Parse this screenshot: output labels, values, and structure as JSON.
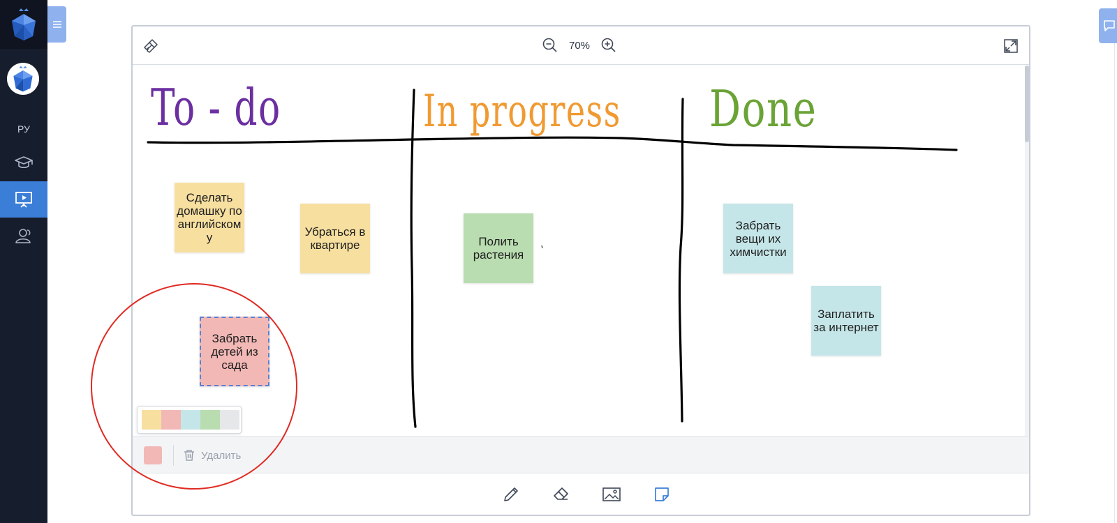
{
  "sidebar": {
    "language": "РУ",
    "items": [
      {
        "icon": "graduation-cap-icon",
        "active": false
      },
      {
        "icon": "presentation-board-icon",
        "active": true
      },
      {
        "icon": "users-icon",
        "active": false
      }
    ]
  },
  "board": {
    "zoom": "70%",
    "columns": [
      {
        "heading": "To - do",
        "color": "#6b2fa0"
      },
      {
        "heading": "In progress",
        "color": "#f09a32"
      },
      {
        "heading": "Done",
        "color": "#6aa336"
      }
    ],
    "notes": [
      {
        "text": "Сделать домашку по английском у",
        "color": "#f7dfa0"
      },
      {
        "text": "Убраться в квартире",
        "color": "#f7dfa0"
      },
      {
        "text": "Полить растения",
        "color": "#b9ddb0"
      },
      {
        "text": "Забрать вещи их химчистки",
        "color": "#c5e6e8"
      },
      {
        "text": "Заплатить за интернет",
        "color": "#c5e6e8"
      },
      {
        "text": "Забрать детей из сада",
        "color": "#f1b8b6",
        "selected": true
      }
    ],
    "palette": [
      "#f7dfa0",
      "#f1b8b6",
      "#c5e6e8",
      "#b9ddb0",
      "#e6e7e9"
    ],
    "selection_bar": {
      "current_color": "#f1b8b6",
      "delete_label": "Удалить"
    },
    "tools": [
      "pencil-icon",
      "eraser-icon",
      "image-icon",
      "sticky-note-icon"
    ]
  },
  "colors": {
    "sidebar_bg": "#161d2c",
    "accent": "#3b7ed8",
    "annotation": "#e02a22"
  }
}
